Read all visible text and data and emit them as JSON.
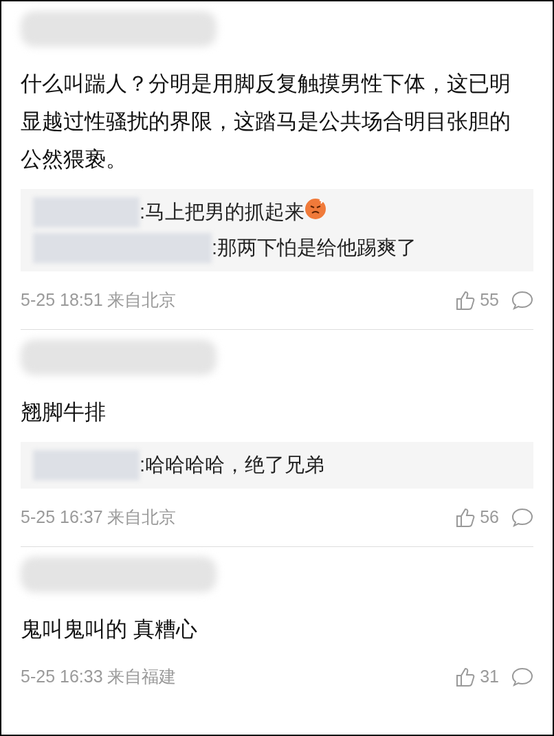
{
  "comments": [
    {
      "text": "什么叫踹人？分明是用脚反复触摸男性下体，这已明显越过性骚扰的界限，这踏马是公共场合明目张胆的公然猥亵。",
      "replies": [
        {
          "text": ":马上把男的抓起来",
          "kind": "with_emoji"
        },
        {
          "text": ":那两下怕是给他踢爽了",
          "kind": "plain"
        }
      ],
      "time": "5-25 18:51 来自北京",
      "likes": "55"
    },
    {
      "text": "翘脚牛排",
      "replies": [
        {
          "text": ":哈哈哈哈，绝了兄弟",
          "kind": "plain"
        }
      ],
      "time": "5-25 16:37 来自北京",
      "likes": "56"
    },
    {
      "text": "鬼叫鬼叫的 真糟心",
      "time": "5-25 16:33 来自福建",
      "likes": "31"
    }
  ]
}
